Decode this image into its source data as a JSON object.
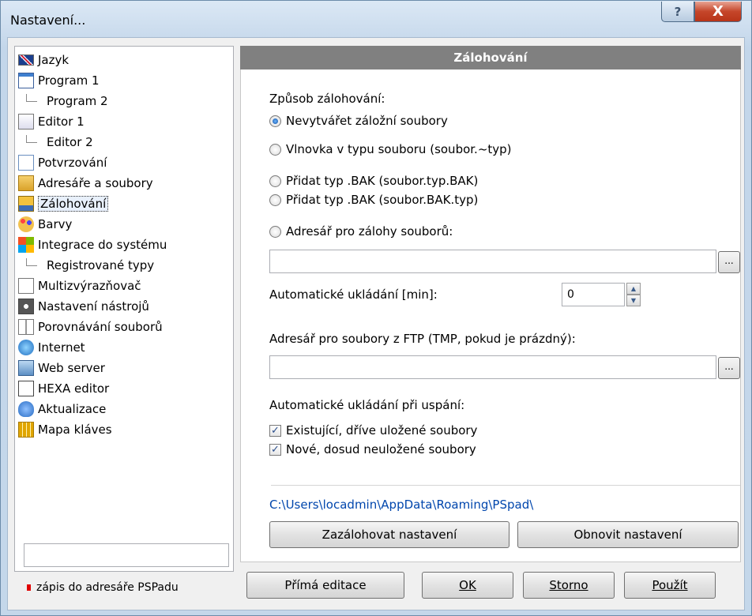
{
  "window": {
    "title": "Nastavení..."
  },
  "icons": {
    "help": "?",
    "close": "X"
  },
  "tree": {
    "items": [
      {
        "label": "Jazyk",
        "icon": "flag-uk-icon",
        "sub": false
      },
      {
        "label": "Program  1",
        "icon": "window-icon",
        "sub": false
      },
      {
        "label": "Program  2",
        "icon": "",
        "sub": true
      },
      {
        "label": "Editor  1",
        "icon": "editor-icon",
        "sub": false
      },
      {
        "label": "Editor  2",
        "icon": "",
        "sub": true
      },
      {
        "label": "Potvrzování",
        "icon": "checklist-icon",
        "sub": false
      },
      {
        "label": "Adresáře a soubory",
        "icon": "folder-icon",
        "sub": false
      },
      {
        "label": "Zálohování",
        "icon": "floppy-icon",
        "sub": false,
        "selected": true
      },
      {
        "label": "Barvy",
        "icon": "palette-icon",
        "sub": false
      },
      {
        "label": "Integrace do systému",
        "icon": "windows-logo-icon",
        "sub": false
      },
      {
        "label": "Registrované typy",
        "icon": "",
        "sub": true
      },
      {
        "label": "Multizvýrazňovač",
        "icon": "document-icon",
        "sub": false
      },
      {
        "label": "Nastavení nástrojů",
        "icon": "gear-icon",
        "sub": false
      },
      {
        "label": "Porovnávání souborů",
        "icon": "compare-icon",
        "sub": false
      },
      {
        "label": "Internet",
        "icon": "globe-icon",
        "sub": false
      },
      {
        "label": "Web server",
        "icon": "web-server-icon",
        "sub": false
      },
      {
        "label": "HEXA editor",
        "icon": "hex-icon",
        "sub": false
      },
      {
        "label": "Aktualizace",
        "icon": "cloud-download-icon",
        "sub": false
      },
      {
        "label": "Mapa kláves",
        "icon": "keyboard-icon",
        "sub": false
      }
    ],
    "note": "zápis do adresáře PSPadu"
  },
  "section": {
    "header": "Zálohování",
    "backup_mode_label": "Způsob zálohování:",
    "radios": [
      {
        "label": "Nevytvářet záložní soubory",
        "checked": true
      },
      {
        "label": "Vlnovka v typu souboru  (soubor.~typ)",
        "checked": false
      },
      {
        "label": "Přidat typ .BAK  (soubor.typ.BAK)",
        "checked": false
      },
      {
        "label": "Přidat typ .BAK  (soubor.BAK.typ)",
        "checked": false
      },
      {
        "label": "Adresář pro zálohy souborů:",
        "checked": false
      }
    ],
    "backup_dir_value": "",
    "browse_label": "...",
    "autosave_label": "Automatické ukládání [min]:",
    "autosave_value": "0",
    "ftp_label": "Adresář pro soubory z FTP (TMP, pokud je prázdný):",
    "ftp_dir_value": "",
    "sleep_label": "Automatické ukládání při uspání:",
    "checks": [
      {
        "label": "Existující, dříve uložené soubory",
        "checked": true
      },
      {
        "label": "Nové, dosud neuložené soubory",
        "checked": true
      }
    ],
    "path": "C:\\Users\\locadmin\\AppData\\Roaming\\PSpad\\",
    "backup_settings_button": "Zazálohovat nastavení",
    "restore_settings_button": "Obnovit nastavení"
  },
  "footer": {
    "direct_edit": "Přímá editace",
    "ok": "OK",
    "cancel": "Storno",
    "apply": "Použít"
  }
}
